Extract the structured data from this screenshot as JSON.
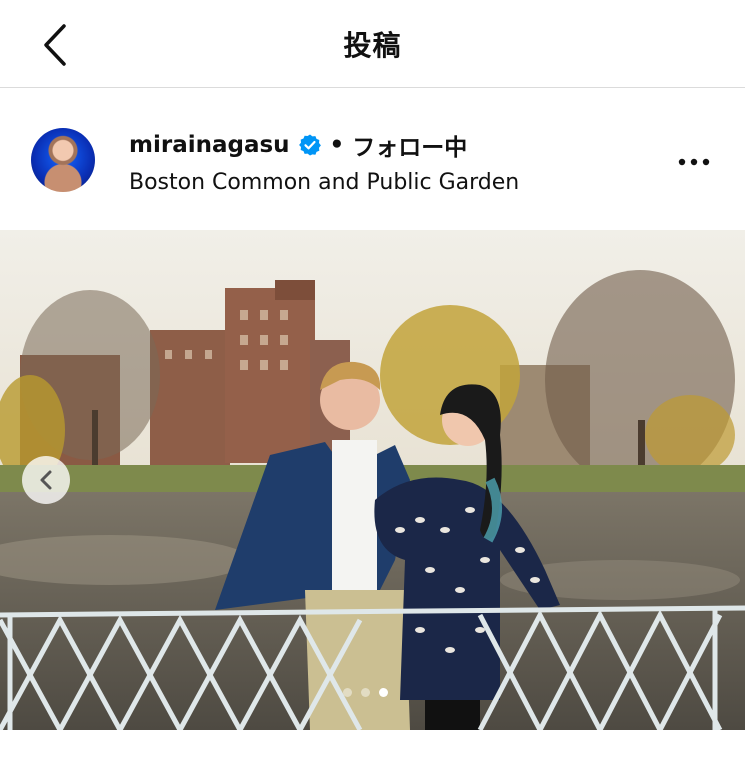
{
  "header": {
    "title": "投稿",
    "back_icon": "chevron-left-icon"
  },
  "post": {
    "username": "mirainagasu",
    "verified_icon": "verified-badge-icon",
    "separator": "•",
    "follow_status": "フォロー中",
    "location": "Boston Common and Public Garden",
    "more_icon": "more-horizontal-icon"
  },
  "carousel": {
    "prev_icon": "chevron-left-icon",
    "slide_count": 3,
    "active_index": 2
  },
  "colors": {
    "verified": "#0095f6",
    "divider": "#dbdbdb",
    "text": "#111111"
  }
}
